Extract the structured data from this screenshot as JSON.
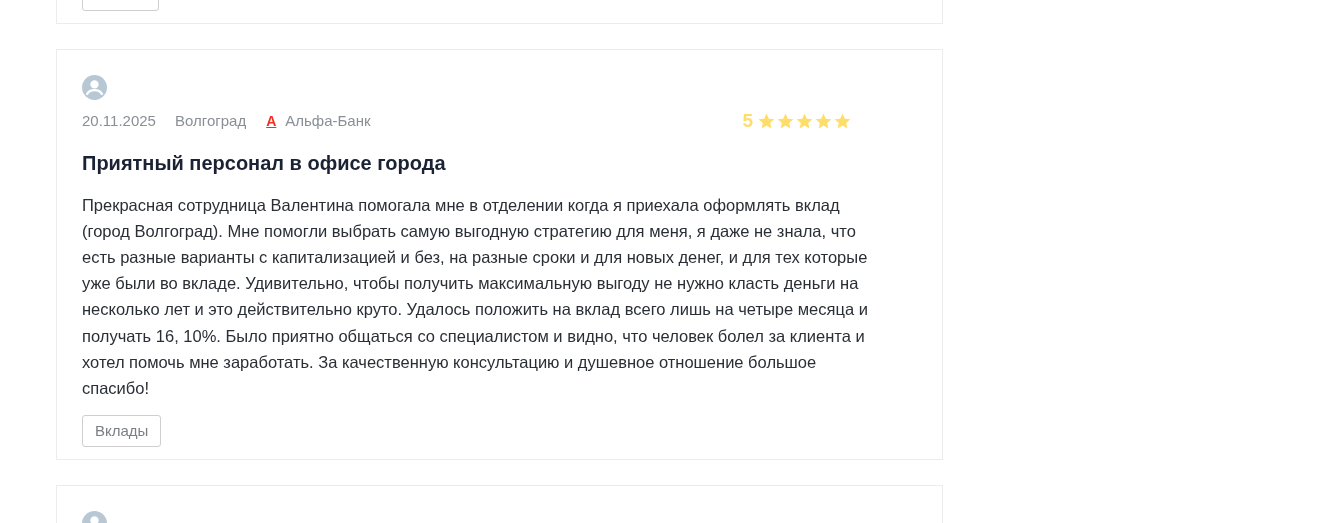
{
  "reviews": [
    {
      "kind": "cut_tag"
    },
    {
      "avatar": true,
      "date": "20.11.2025",
      "city": "Волгоград",
      "bank": "Альфа-Банк",
      "bank_logo": "А",
      "score": "5",
      "stars": 5,
      "title": "Приятный персонал в офисе города",
      "text": "Прекрасная сотрудница Валентина помогала мне в отделении когда я приехала оформлять вклад (город Волгоград). Мне помогли выбрать самую выгодную стратегию для меня, я даже не знала, что есть разные варианты с капитализацией и без, на разные сроки и для новых денег, и для тех которые уже были во вкладе. Удивительно, чтобы получить максимальную выгоду не нужно класть деньги на несколько лет и это действительно круто. Удалось положить на вклад всего лишь на четыре месяца и получать 16, 10%. Было приятно общаться со специалистом и видно, что человек болел за клиента и хотел помочь мне заработать. За качественную консультацию и душевное отношение большое спасибо!",
      "tags": [
        "Вклады"
      ]
    },
    {
      "avatar": true
    }
  ]
}
